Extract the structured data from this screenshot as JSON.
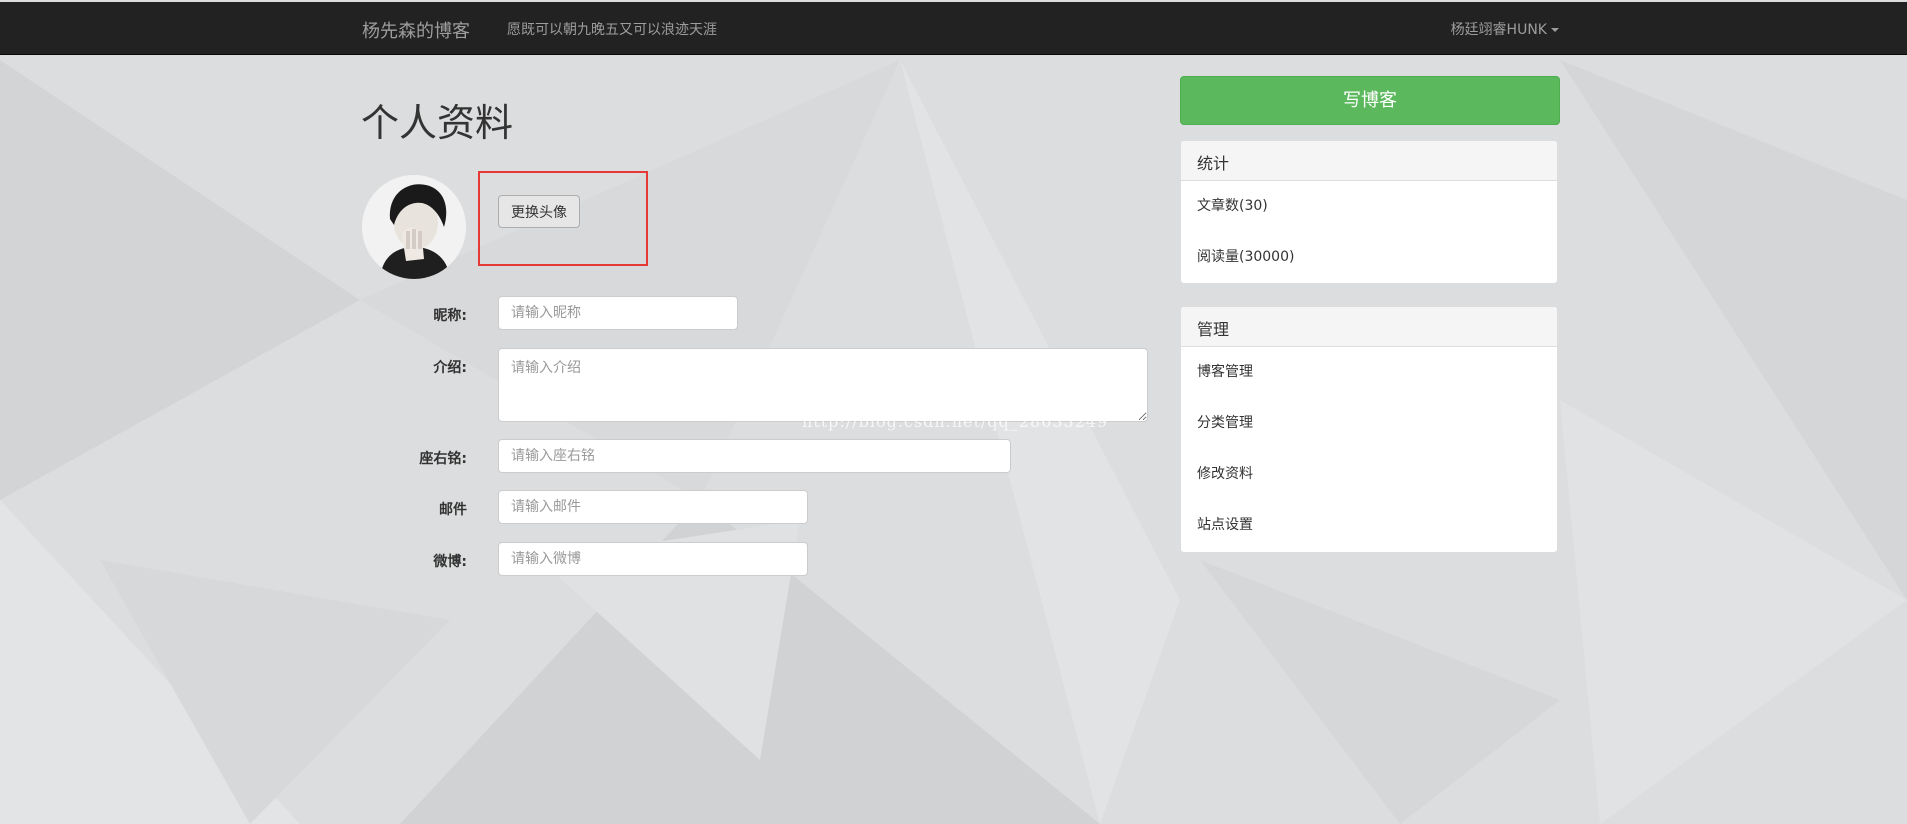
{
  "navbar": {
    "brand": "杨先森的博客",
    "motto": "愿既可以朝九晚五又可以浪迹天涯",
    "user": "杨廷翊睿HUNK"
  },
  "page": {
    "title": "个人资料",
    "change_avatar_label": "更换头像"
  },
  "form": {
    "nickname": {
      "label": "昵称:",
      "placeholder": "请输入昵称",
      "value": ""
    },
    "intro": {
      "label": "介绍:",
      "placeholder": "请输入介绍",
      "value": ""
    },
    "motto": {
      "label": "座右铭:",
      "placeholder": "请输入座右铭",
      "value": ""
    },
    "email": {
      "label": "邮件",
      "placeholder": "请输入邮件",
      "value": ""
    },
    "weibo": {
      "label": "微博:",
      "placeholder": "请输入微博",
      "value": ""
    }
  },
  "watermark": "http://blog.csdn.net/qq_28633249",
  "sidebar": {
    "write_label": "写博客",
    "stats": {
      "heading": "统计",
      "items": [
        {
          "label": "文章数(30)"
        },
        {
          "label": "阅读量(30000)"
        }
      ]
    },
    "manage": {
      "heading": "管理",
      "items": [
        {
          "label": "博客管理"
        },
        {
          "label": "分类管理"
        },
        {
          "label": "修改资料"
        },
        {
          "label": "站点设置"
        }
      ]
    }
  },
  "colors": {
    "navbar": "#222222",
    "success": "#5cb85c",
    "highlight": "#e53935",
    "background": "#dcddde"
  }
}
